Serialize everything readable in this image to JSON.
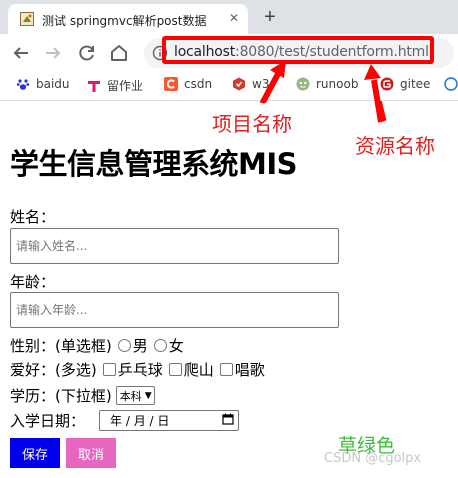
{
  "browser": {
    "tab_title": "测试 springmvc解析post数据",
    "tab_close": "✕",
    "new_tab": "+",
    "url_host": "localhost",
    "url_rest": ":8080/test/studentform.html",
    "bookmarks": [
      {
        "label": "baidu",
        "icon": "paw-icon",
        "color": "#2932e1"
      },
      {
        "label": "留作业",
        "icon": "t-logo-icon",
        "color": "#e5156e"
      },
      {
        "label": "csdn",
        "icon": "c-logo-icon",
        "color": "#fc5531"
      },
      {
        "label": "w3",
        "icon": "w3-logo-icon",
        "color": "#d9362b"
      },
      {
        "label": "runoob",
        "icon": "runoob-logo-icon",
        "color": "#96b97d"
      },
      {
        "label": "gitee",
        "icon": "gitee-logo-icon",
        "color": "#c71d23"
      }
    ]
  },
  "annotations": {
    "project_name": "项目名称",
    "resource_name": "资源名称",
    "color_note": "草绿色",
    "arrow_color": "#ff0000"
  },
  "form": {
    "title": "学生信息管理系统MIS",
    "name_label": "姓名：",
    "name_placeholder": "请输入姓名...",
    "age_label": "年龄：",
    "age_placeholder": "请输入年龄...",
    "gender_label": "性别：(单选框)",
    "gender_options": [
      "男",
      "女"
    ],
    "hobby_label": "爱好：(多选)",
    "hobby_options": [
      "乒乓球",
      "爬山",
      "唱歌"
    ],
    "education_label": "学历：(下拉框)",
    "education_selected": "本科",
    "enroll_label": "入学日期：",
    "date_placeholder": "年 / 月 / 日",
    "save_label": "保存",
    "cancel_label": "取消"
  },
  "watermark": "CSDN @cgolpx",
  "colors": {
    "save_bg": "#0000ee",
    "cancel_bg": "#e667c0",
    "note_green": "#3cbc3c",
    "annotation_red": "#e02020"
  }
}
